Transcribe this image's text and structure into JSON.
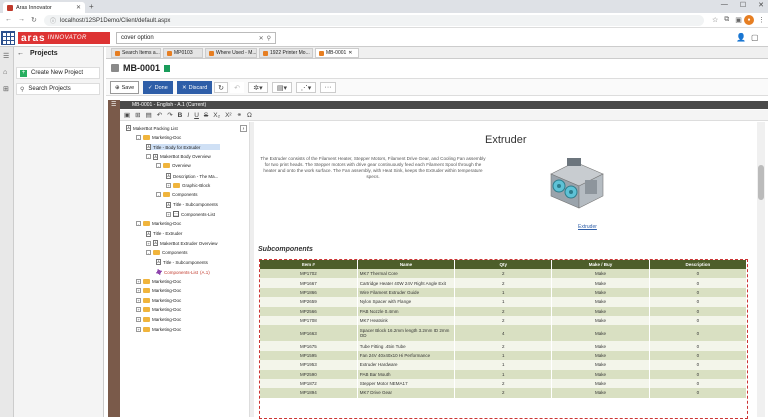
{
  "browser": {
    "tab_title": "Aras Innovator",
    "url": "localhost/12SP1Demo/Client/default.aspx"
  },
  "header": {
    "logo_main": "aras",
    "logo_sub": "INNOVATOR",
    "search_value": "cover option"
  },
  "leftnav": {
    "title": "Projects",
    "items": [
      {
        "label": "Create New Project"
      },
      {
        "label": "Search Projects"
      }
    ]
  },
  "doc_tabs": [
    {
      "label": "Search Items a..."
    },
    {
      "label": "MP0103"
    },
    {
      "label": "Where Used - M..."
    },
    {
      "label": "1922 Printer Mo..."
    },
    {
      "label": "MB-0001"
    }
  ],
  "item": {
    "title": "MB-0001"
  },
  "toolbar": {
    "save": "Save",
    "done": "Done",
    "discard": "Discard"
  },
  "doc_header": "MB-0001 - English - A.1 (Current)",
  "tree": [
    {
      "label": "MakerBot Packing List",
      "level": 0,
      "icon": "doc"
    },
    {
      "label": "Marketing-Doc",
      "level": 1,
      "icon": "folder",
      "exp": "-"
    },
    {
      "label": "Title - Body for Extruder",
      "level": 2,
      "icon": "doc",
      "selected": true
    },
    {
      "label": "MakerBot Body Overview",
      "level": 2,
      "icon": "doc",
      "exp": "-"
    },
    {
      "label": "Overview",
      "level": 3,
      "icon": "folder",
      "exp": "-"
    },
    {
      "label": "Description - The Ma...",
      "level": 4,
      "icon": "doc"
    },
    {
      "label": "Graphic-Block",
      "level": 4,
      "icon": "folder",
      "exp": "+"
    },
    {
      "label": "Components",
      "level": 3,
      "icon": "folder",
      "exp": "-"
    },
    {
      "label": "Title - Subcomponents",
      "level": 4,
      "icon": "doc"
    },
    {
      "label": "Components-List",
      "level": 4,
      "icon": "table",
      "exp": "+"
    },
    {
      "label": "Marketing-Doc",
      "level": 1,
      "icon": "folder",
      "exp": "-"
    },
    {
      "label": "Title - Extruder",
      "level": 2,
      "icon": "doc"
    },
    {
      "label": "MakerBot Extruder Overview",
      "level": 2,
      "icon": "doc",
      "exp": "+"
    },
    {
      "label": "Components",
      "level": 2,
      "icon": "folder",
      "exp": "-"
    },
    {
      "label": "Title - Subcomponents",
      "level": 3,
      "icon": "doc"
    },
    {
      "label": "Components-List",
      "level": 3,
      "icon": "gear",
      "suffix": "(A.1)",
      "red": true
    },
    {
      "label": "Marketing-Doc",
      "level": 1,
      "icon": "folder",
      "exp": "+"
    },
    {
      "label": "Marketing-Doc",
      "level": 1,
      "icon": "folder",
      "exp": "+"
    },
    {
      "label": "Marketing-Doc",
      "level": 1,
      "icon": "folder",
      "exp": "+"
    },
    {
      "label": "Marketing-Doc",
      "level": 1,
      "icon": "folder",
      "exp": "+"
    },
    {
      "label": "Marketing-Doc",
      "level": 1,
      "icon": "folder",
      "exp": "+"
    },
    {
      "label": "Marketing-Doc",
      "level": 1,
      "icon": "folder",
      "exp": "+"
    }
  ],
  "content": {
    "title": "Extruder",
    "paragraph": "The Extruder consists of the Filament Heater, Stepper Motors, Filament Drive Gear, and Cooling Fan assembly for two print heads. The Stepper motors with drive gear continuously feed each Filament Spool through the heater and onto the work surface. The Fan assembly, with Heat Sink, keeps the Extruder within temperature specs.",
    "image_caption": "Extruder",
    "subcomponents_title": "Subcomponents",
    "table_headers": [
      "Item #",
      "Name",
      "Qty",
      "Make / Buy",
      "Description"
    ],
    "rows": [
      [
        "MP1702",
        "MK7 Thermal Core",
        "2",
        "Make",
        "0"
      ],
      [
        "MP1667",
        "Cartridge Heater 40W 24V Right Angle Exit",
        "2",
        "Make",
        "0"
      ],
      [
        "MP1866",
        "Wire Filament Extruder Guide",
        "1",
        "Make",
        "0"
      ],
      [
        "MP2659",
        "Nylon Spacer with Flange",
        "1",
        "Make",
        "0"
      ],
      [
        "MP2566",
        "PAB Nozzle 0.4mm",
        "2",
        "Make",
        "0"
      ],
      [
        "MP1708",
        "MK7 Heatsink",
        "2",
        "Make",
        "0"
      ],
      [
        "MP1663",
        "Spacer Block 16.2mm length 3.2mm ID 2mm OD",
        "4",
        "Make",
        "0"
      ],
      [
        "MP1675",
        "Tube Fitting .45in Tube",
        "2",
        "Make",
        "0"
      ],
      [
        "MP1595",
        "Fan 24V 40x40x10 Hi Performance",
        "1",
        "Make",
        "0"
      ],
      [
        "MP1953",
        "Extruder Hardware",
        "1",
        "Make",
        "0"
      ],
      [
        "MP2590",
        "PAB Bar Mouth",
        "1",
        "Make",
        "0"
      ],
      [
        "MP1872",
        "Stepper Motor NEMA17",
        "2",
        "Make",
        "0"
      ],
      [
        "MP1894",
        "MK7 Drive Gear",
        "2",
        "Make",
        "0"
      ]
    ]
  }
}
